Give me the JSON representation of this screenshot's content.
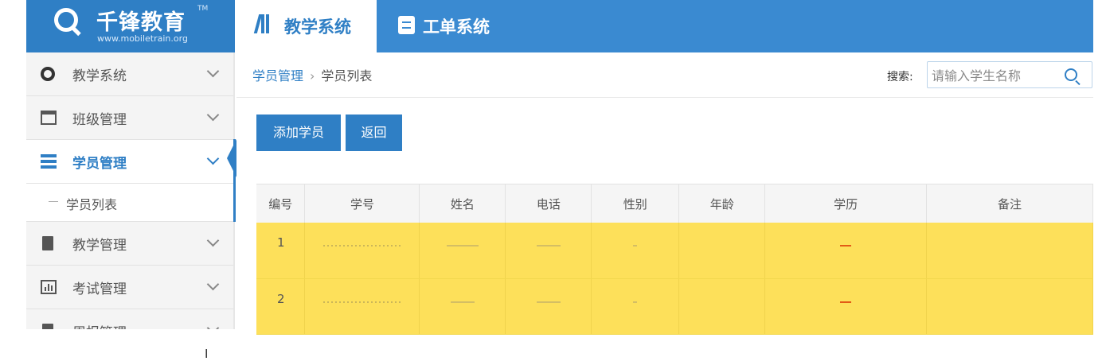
{
  "brand": {
    "name": "千锋教育",
    "tm": "TM",
    "url": "www.mobiletrain.org"
  },
  "top_tabs": [
    {
      "label": "教学系统",
      "active": true
    },
    {
      "label": "工单系统",
      "active": false
    }
  ],
  "sidebar": {
    "items": [
      {
        "label": "教学系统",
        "icon": "gear-icon"
      },
      {
        "label": "班级管理",
        "icon": "calendar-icon"
      },
      {
        "label": "学员管理",
        "icon": "list-icon",
        "active": true
      },
      {
        "label": "教学管理",
        "icon": "document-icon"
      },
      {
        "label": "考试管理",
        "icon": "bar-chart-icon"
      },
      {
        "label": "周报管理",
        "icon": "report-icon"
      }
    ],
    "sub_item": {
      "label": "学员列表"
    }
  },
  "breadcrumb": {
    "parent": "学员管理",
    "separator": "›",
    "current": "学员列表"
  },
  "search": {
    "label": "搜索:",
    "placeholder": "请输入学生名称"
  },
  "buttons": {
    "add": "添加学员",
    "back": "返回"
  },
  "table": {
    "headers": [
      "编号",
      "学号",
      "姓名",
      "电话",
      "性别",
      "年龄",
      "学历",
      "备注"
    ],
    "rows": [
      {
        "no": "1"
      },
      {
        "no": "2"
      }
    ]
  },
  "colors": {
    "header_blue": "#3a8ad1",
    "accent": "#2f7fc5",
    "row_highlight": "#fde05a"
  }
}
